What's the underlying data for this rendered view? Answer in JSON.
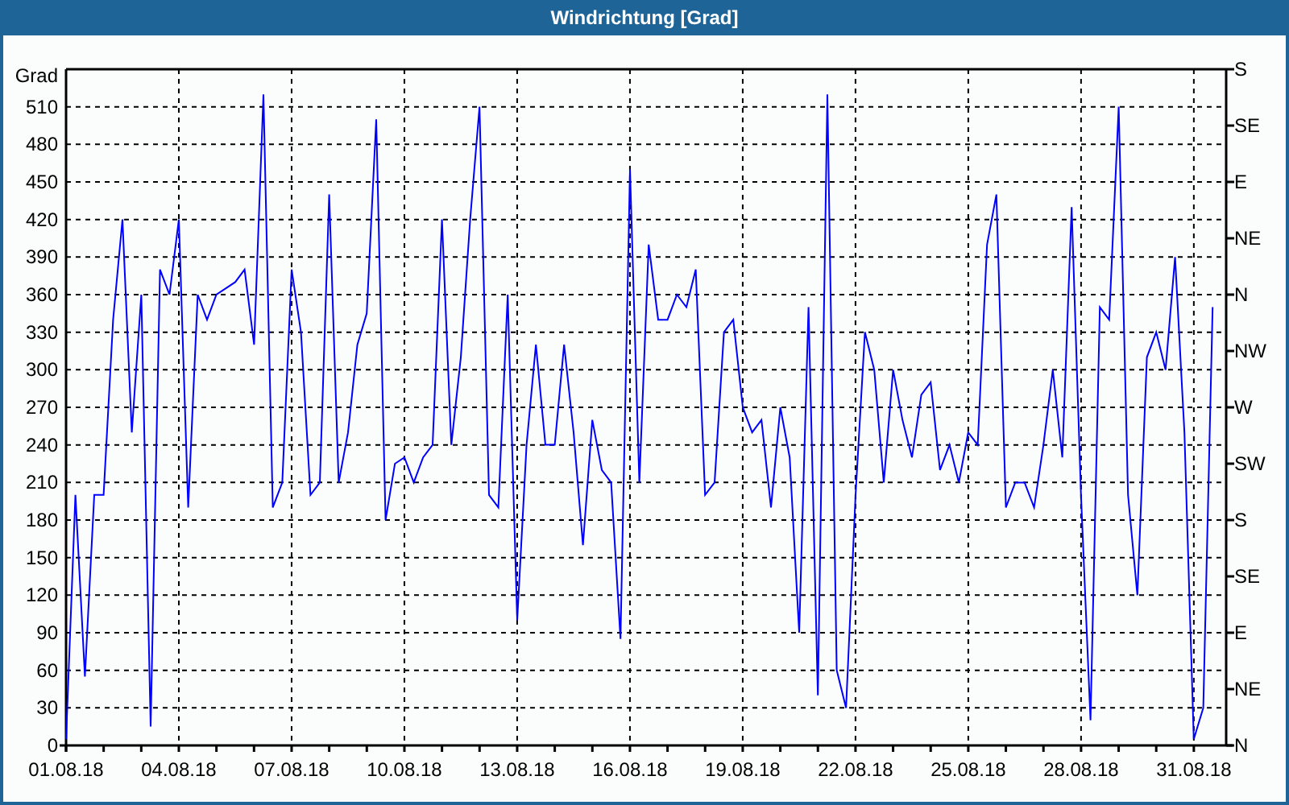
{
  "window": {
    "title": "Windrichtung [Grad]"
  },
  "chart": {
    "chart_data": {
      "type": "line",
      "ylabel": "Grad",
      "ylim": [
        0,
        540
      ],
      "grid": true,
      "categories": [
        "01.08.18",
        null,
        null,
        null,
        null,
        null,
        null,
        null,
        null,
        null,
        null,
        null,
        "04.08.18",
        null,
        null,
        null,
        null,
        null,
        null,
        null,
        null,
        null,
        null,
        null,
        "07.08.18",
        null,
        null,
        null,
        null,
        null,
        null,
        null,
        null,
        null,
        null,
        null,
        "10.08.18",
        null,
        null,
        null,
        null,
        null,
        null,
        null,
        null,
        null,
        null,
        null,
        "13.08.18",
        null,
        null,
        null,
        null,
        null,
        null,
        null,
        null,
        null,
        null,
        null,
        "16.08.18",
        null,
        null,
        null,
        null,
        null,
        null,
        null,
        null,
        null,
        null,
        null,
        "19.08.18",
        null,
        null,
        null,
        null,
        null,
        null,
        null,
        null,
        null,
        null,
        null,
        "22.08.18",
        null,
        null,
        null,
        null,
        null,
        null,
        null,
        null,
        null,
        null,
        null,
        "25.08.18",
        null,
        null,
        null,
        null,
        null,
        null,
        null,
        null,
        null,
        null,
        null,
        "28.08.18",
        null,
        null,
        null,
        null,
        null,
        null,
        null,
        null,
        null,
        null,
        null,
        "31.08.18",
        null,
        null
      ],
      "yticks": [
        0,
        30,
        60,
        90,
        120,
        150,
        180,
        210,
        240,
        270,
        300,
        330,
        360,
        390,
        420,
        450,
        480,
        510
      ],
      "series": [
        {
          "color": "#0000ff",
          "values": [
            5,
            200,
            55,
            200,
            200,
            340,
            420,
            250,
            360,
            15,
            380,
            360,
            420,
            190,
            360,
            340,
            360,
            365,
            370,
            380,
            320,
            520,
            190,
            210,
            380,
            330,
            200,
            210,
            440,
            210,
            250,
            320,
            345,
            500,
            180,
            225,
            230,
            210,
            230,
            240,
            420,
            240,
            310,
            420,
            510,
            200,
            190,
            360,
            100,
            240,
            320,
            240,
            240,
            320,
            250,
            160,
            260,
            220,
            210,
            85,
            460,
            210,
            400,
            340,
            340,
            360,
            350,
            380,
            200,
            210,
            330,
            340,
            270,
            250,
            260,
            190,
            270,
            230,
            90,
            350,
            40,
            520,
            60,
            30,
            200,
            330,
            300,
            210,
            300,
            260,
            230,
            280,
            290,
            220,
            240,
            210,
            250,
            240,
            400,
            440,
            190,
            210,
            210,
            190,
            240,
            300,
            230,
            430,
            200,
            20,
            350,
            340,
            510,
            200,
            120,
            310,
            330,
            300,
            390,
            250,
            5,
            30,
            350
          ]
        }
      ]
    },
    "direction_labels": [
      "S",
      "SE",
      "E",
      "NE",
      "N",
      "NW",
      "W",
      "SW",
      "S",
      "SE",
      "E",
      "NE",
      "N"
    ]
  }
}
